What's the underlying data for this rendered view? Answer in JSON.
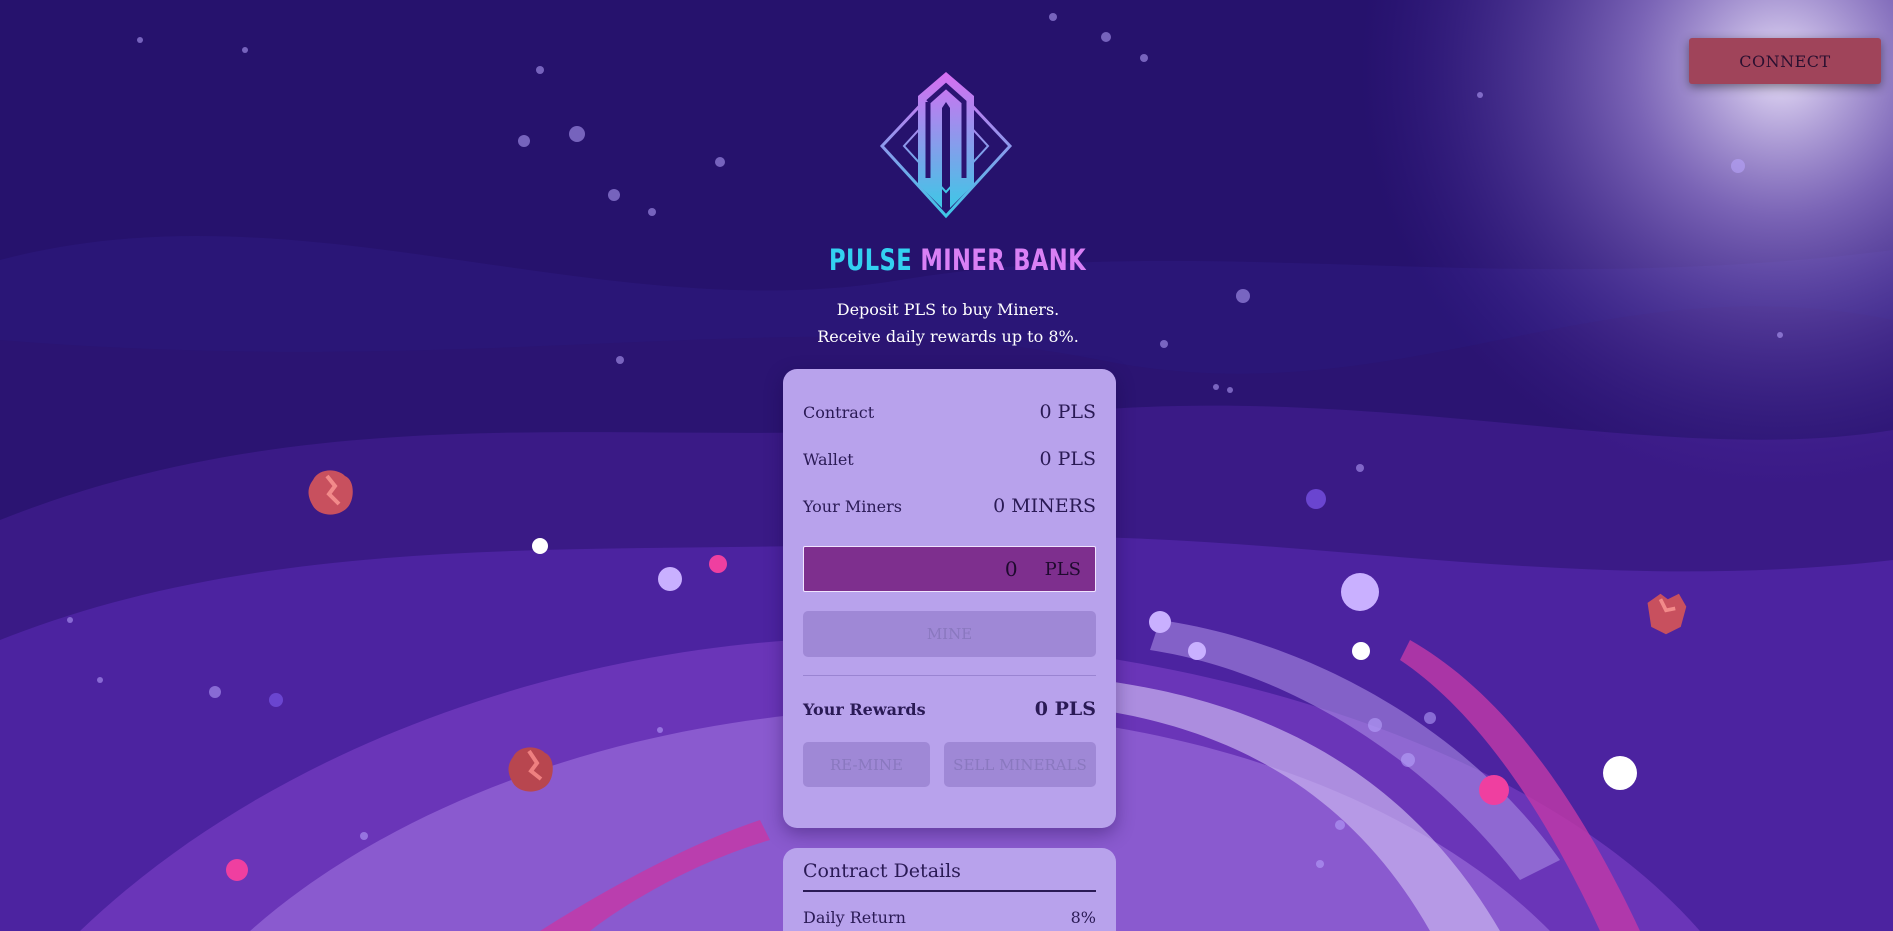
{
  "header": {
    "connect_label": "CONNECT",
    "brand_word1": "PULSE",
    "brand_word2": "MINER BANK",
    "tagline_line1": "Deposit PLS to buy Miners.",
    "tagline_line2": "Receive daily rewards up to 8%."
  },
  "stats": {
    "contract_label": "Contract",
    "contract_value": "0 PLS",
    "wallet_label": "Wallet",
    "wallet_value": "0 PLS",
    "miners_label": "Your Miners",
    "miners_value": "0 MINERS"
  },
  "deposit": {
    "amount_value": "0",
    "amount_unit": "PLS",
    "mine_label": "MINE"
  },
  "rewards": {
    "label": "Your Rewards",
    "value": "0 PLS",
    "remine_label": "RE-MINE",
    "sell_label": "SELL MINERALS"
  },
  "contract_details": {
    "title": "Contract Details",
    "daily_return_label": "Daily Return",
    "daily_return_value": "8%"
  },
  "colors": {
    "background": "#2b1472",
    "card": "#b8a2ec",
    "connect_button": "#a0445a",
    "input": "#7e2f8e",
    "brand_cyan": "#33d1f0",
    "brand_pink": "#d980f5"
  },
  "icons": {
    "logo": "pulse-miner-bank-logo",
    "decor": "mineral-rock-icon"
  }
}
